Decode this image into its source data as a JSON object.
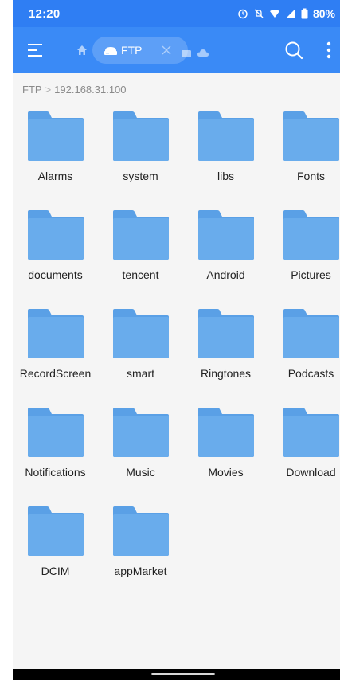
{
  "status_bar": {
    "time": "12:20",
    "battery": "80%",
    "icons": [
      "alarm-icon",
      "mute-icon",
      "wifi-icon",
      "signal-icon",
      "battery-icon"
    ]
  },
  "app_bar": {
    "tab_label": "FTP",
    "icons": [
      "menu-icon",
      "home-icon",
      "ftp-icon",
      "close-icon",
      "window-icon",
      "cloud-icon",
      "search-icon",
      "more-icon"
    ]
  },
  "breadcrumb": {
    "root": "FTP",
    "separator": ">",
    "current": "192.168.31.100"
  },
  "folders": [
    {
      "name": "Alarms"
    },
    {
      "name": "system"
    },
    {
      "name": "libs"
    },
    {
      "name": "Fonts"
    },
    {
      "name": "documents"
    },
    {
      "name": "tencent"
    },
    {
      "name": "Android"
    },
    {
      "name": "Pictures"
    },
    {
      "name": "RecordScreen"
    },
    {
      "name": "smart"
    },
    {
      "name": "Ringtones"
    },
    {
      "name": "Podcasts"
    },
    {
      "name": "Notifications"
    },
    {
      "name": "Music"
    },
    {
      "name": "Movies"
    },
    {
      "name": "Download"
    },
    {
      "name": "DCIM"
    },
    {
      "name": "appMarket"
    }
  ],
  "colors": {
    "status_bar": "#2f7ef3",
    "app_bar": "#3a8af6",
    "folder": "#69acec",
    "folder_tab": "#5aa0e6",
    "background": "#f5f5f5"
  }
}
